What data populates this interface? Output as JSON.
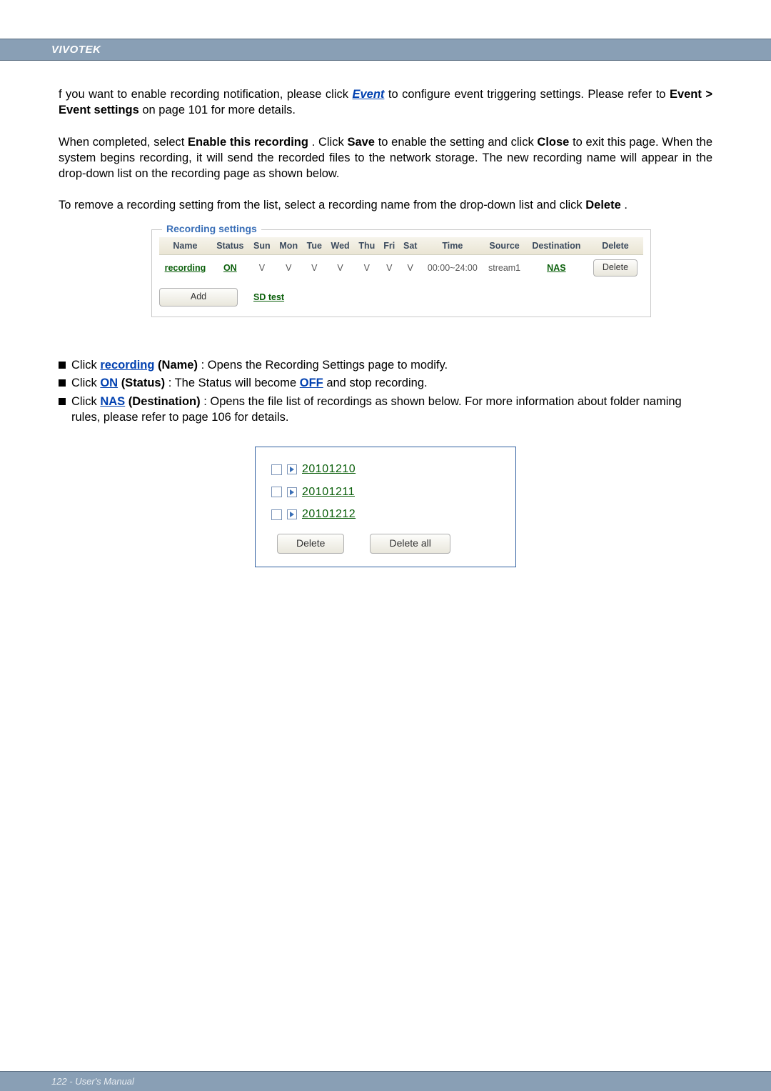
{
  "header": {
    "brand": "VIVOTEK"
  },
  "footer": {
    "text": "122 - User's Manual"
  },
  "intro": {
    "p1_a": "f you want to enable recording notification, please click ",
    "p1_link": "Event",
    "p1_b": " to configure event triggering settings. Please refer to ",
    "p1_bold": "Event > Event settings",
    "p1_c": " on page 101 for more details.",
    "p2_a": "When completed, select ",
    "p2_b1": "Enable this recording",
    "p2_b": ". Click ",
    "p2_b2": "Save",
    "p2_c": " to enable the setting and click ",
    "p2_b3": "Close",
    "p2_d": " to exit this page. When the system begins recording, it will send the recorded files to the network storage. The new recording name will appear in the drop-down list on the recording page as shown below.",
    "p3_a": "To remove a recording setting from the list, select a recording name from the drop-down list and click ",
    "p3_b": "Delete",
    "p3_c": "."
  },
  "rec": {
    "legend": "Recording settings",
    "headers": [
      "Name",
      "Status",
      "Sun",
      "Mon",
      "Tue",
      "Wed",
      "Thu",
      "Fri",
      "Sat",
      "Time",
      "Source",
      "Destination",
      "Delete"
    ],
    "row": {
      "name": "recording",
      "status": "ON",
      "days": [
        "V",
        "V",
        "V",
        "V",
        "V",
        "V",
        "V"
      ],
      "time": "00:00~24:00",
      "source": "stream1",
      "dest": "NAS",
      "delete_btn": "Delete"
    },
    "add_btn": "Add",
    "sd_link": "SD test"
  },
  "bullets": {
    "b1_a": "Click ",
    "b1_link": "recording",
    "b1_bold": " (Name)",
    "b1_b": ": Opens the Recording Settings page to modify.",
    "b2_a": "Click ",
    "b2_link": "ON",
    "b2_bold": " (Status)",
    "b2_b": ": The Status will become ",
    "b2_link2": "OFF",
    "b2_c": " and stop recording.",
    "b3_a": "Click ",
    "b3_link": "NAS",
    "b3_bold": " (Destination)",
    "b3_b": ": Opens the file list of recordings as shown below. For more information about folder naming rules, please refer to page 106 for details."
  },
  "filelist": {
    "items": [
      "20101210",
      "20101211",
      "20101212"
    ],
    "delete_btn": "Delete",
    "delete_all_btn": "Delete all"
  }
}
